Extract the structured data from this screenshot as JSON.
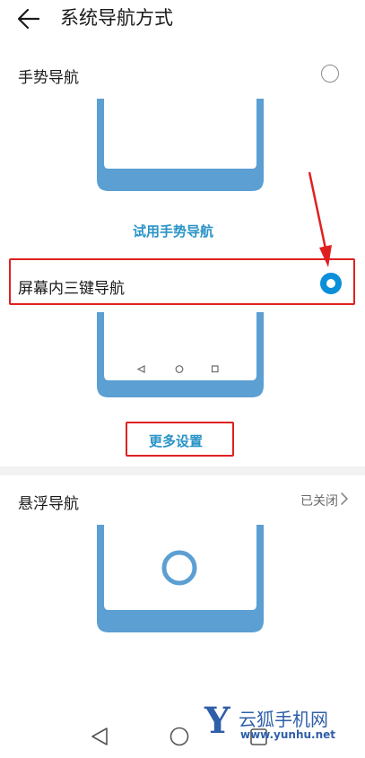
{
  "header": {
    "title": "系统导航方式",
    "back_icon": "arrow-left-icon"
  },
  "gesture": {
    "label": "手势导航",
    "selected": false,
    "try_link": "试用手势导航"
  },
  "three_key": {
    "label": "屏幕内三键导航",
    "selected": true,
    "more_settings": "更多设置"
  },
  "floating": {
    "label": "悬浮导航",
    "status": "已关闭"
  },
  "nav_bar": {
    "icons": [
      "back-triangle-icon",
      "home-circle-icon",
      "recent-square-icon"
    ]
  },
  "watermark": {
    "logo_letter": "Y",
    "name": "云狐手机网",
    "url": "www.yunhu.net"
  },
  "colors": {
    "accent": "#0a8fd8",
    "link": "#2a93c8",
    "phone_frame": "#5b9fd3",
    "highlight": "#e02020"
  }
}
